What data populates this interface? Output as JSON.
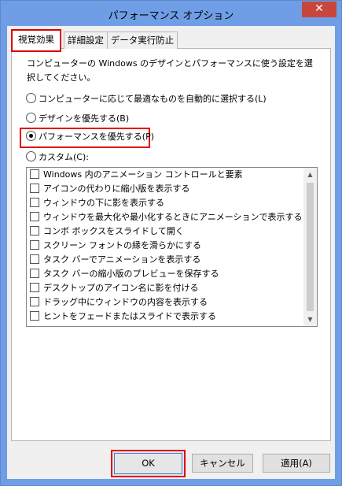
{
  "window": {
    "title": "パフォーマンス オプション",
    "close_glyph": "✕"
  },
  "tabs": [
    {
      "label": "視覚効果",
      "active": true
    },
    {
      "label": "詳細設定",
      "active": false
    },
    {
      "label": "データ実行防止",
      "active": false
    }
  ],
  "description": "コンピューターの Windows のデザインとパフォーマンスに使う設定を選択してください。",
  "radios": [
    {
      "label": "コンピューターに応じて最適なものを自動的に選択する(L)",
      "selected": false
    },
    {
      "label": "デザインを優先する(B)",
      "selected": false
    },
    {
      "label": "パフォーマンスを優先する(P)",
      "selected": true
    },
    {
      "label": "カスタム(C):",
      "selected": false
    }
  ],
  "effects": [
    {
      "label": "Windows 内のアニメーション コントロールと要素",
      "checked": false
    },
    {
      "label": "アイコンの代わりに縮小版を表示する",
      "checked": false
    },
    {
      "label": "ウィンドウの下に影を表示する",
      "checked": false
    },
    {
      "label": "ウィンドウを最大化や最小化するときにアニメーションで表示する",
      "checked": false
    },
    {
      "label": "コンボ ボックスをスライドして開く",
      "checked": false
    },
    {
      "label": "スクリーン フォントの縁を滑らかにする",
      "checked": false
    },
    {
      "label": "タスク バーでアニメーションを表示する",
      "checked": false
    },
    {
      "label": "タスク バーの縮小版のプレビューを保存する",
      "checked": false
    },
    {
      "label": "デスクトップのアイコン名に影を付ける",
      "checked": false
    },
    {
      "label": "ドラッグ中にウィンドウの内容を表示する",
      "checked": false
    },
    {
      "label": "ヒントをフェードまたはスライドで表示する",
      "checked": false
    }
  ],
  "buttons": {
    "ok": "OK",
    "cancel": "キャンセル",
    "apply": "適用(A)"
  },
  "colors": {
    "title_bar": "#6f9ee6",
    "highlight": "#e00000",
    "close": "#c9463d"
  }
}
